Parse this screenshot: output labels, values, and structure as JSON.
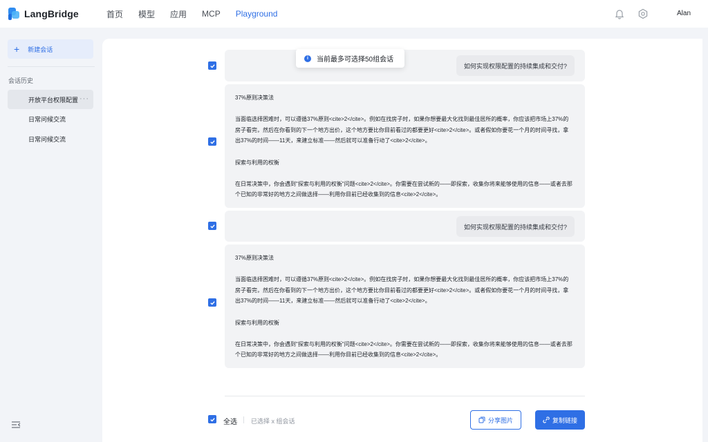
{
  "header": {
    "logo_text": "LangBridge",
    "nav": [
      "首页",
      "模型",
      "应用",
      "MCP",
      "Playground"
    ],
    "active_nav": "Playground",
    "user_name": "Alan"
  },
  "sidebar": {
    "new_chat_label": "新建会话",
    "history_title": "会话历史",
    "items": [
      {
        "label": "开放平台权限配置"
      },
      {
        "label": "日常问候交流"
      },
      {
        "label": "日常问候交流"
      }
    ]
  },
  "toast": {
    "text": "当前最多可选择50组会话"
  },
  "conversation": [
    {
      "type": "question",
      "text": "如何实现权限配置的持续集成和交付?",
      "checked": true
    },
    {
      "type": "answer",
      "checked": true,
      "paragraphs": [
        "37%原则决策法",
        "当面临选择困难时，可以遵循37%原则<cite>2</cite>。例如在找房子时，如果你想要最大化找到最佳居所的概率，你应该把市场上37%的房子看完，然后在你看到的下一个地方出价，这个地方要比你目前看过的都要更好<cite>2</cite>。或者假如你要花一个月的时间寻找，拿出37%的时间——11天，来建立标准——然后就可以准备行动了<cite>2</cite>。",
        "探索与利用的权衡",
        "在日常决策中，你会遇到\"探索与利用的权衡\"问题<cite>2</cite>。你需要在尝试新的——即探索，收集你将来能够使用的信息——或者去那个已知的非常好的地方之间做选择——利用你目前已经收集到的信息<cite>2</cite>。"
      ]
    },
    {
      "type": "question",
      "text": "如何实现权限配置的持续集成和交付?",
      "checked": true
    },
    {
      "type": "answer",
      "checked": true,
      "paragraphs": [
        "37%原则决策法",
        "当面临选择困难时，可以遵循37%原则<cite>2</cite>。例如在找房子时，如果你想要最大化找到最佳居所的概率，你应该把市场上37%的房子看完，然后在你看到的下一个地方出价，这个地方要比你目前看过的都要更好<cite>2</cite>。或者假如你要花一个月的时间寻找，拿出37%的时间——11天，来建立标准——然后就可以准备行动了<cite>2</cite>。",
        "探索与利用的权衡",
        "在日常决策中，你会遇到\"探索与利用的权衡\"问题<cite>2</cite>。你需要在尝试新的——即探索，收集你将来能够使用的信息——或者去那个已知的非常好的地方之间做选择——利用你目前已经收集到的信息<cite>2</cite>。"
      ]
    }
  ],
  "footer": {
    "select_all_label": "全选",
    "selected_count_text": "已选择 x 组会话",
    "share_image_label": "分享图片",
    "copy_link_label": "复制链接"
  },
  "colors": {
    "accent": "#2f6fe5",
    "card_bg": "#f2f3f5",
    "page_bg": "#f2f4f8"
  },
  "icons": {
    "bell": "bell-icon",
    "settings": "gear-icon",
    "collapse": "collapse-sidebar-icon",
    "info": "info-icon",
    "share": "image-share-icon",
    "copy": "link-icon"
  }
}
